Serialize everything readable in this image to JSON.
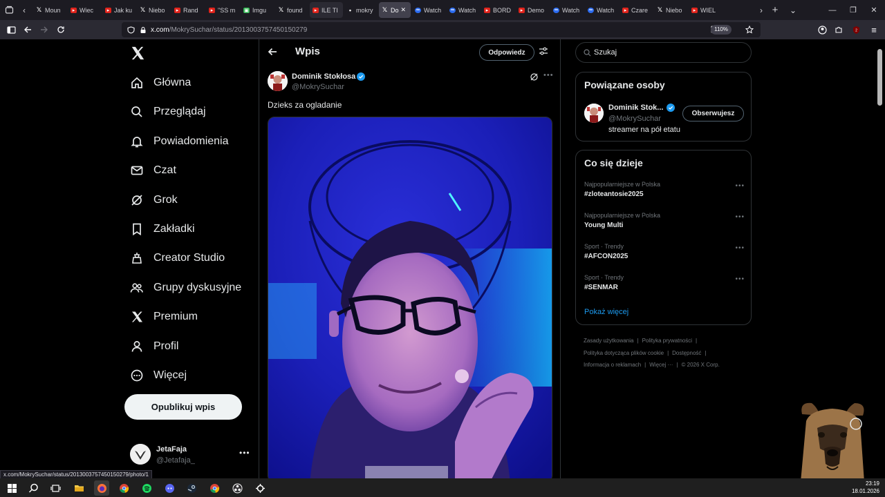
{
  "browser": {
    "tabs": [
      {
        "label": "",
        "icon": "scroll-tabs-left-icon"
      },
      {
        "label": "Moun",
        "icon": "x-logo-icon"
      },
      {
        "label": "Wiec",
        "icon": "youtube-icon"
      },
      {
        "label": "Jak ku",
        "icon": "youtube-icon"
      },
      {
        "label": "Niebo",
        "icon": "x-logo-icon"
      },
      {
        "label": "Rand",
        "icon": "youtube-icon"
      },
      {
        "label": "\"SS m",
        "icon": "youtube-icon"
      },
      {
        "label": "Imgu",
        "icon": "imgur-icon"
      },
      {
        "label": "found",
        "icon": "x-logo-icon"
      },
      {
        "label": "ILE TI",
        "icon": "youtube-icon"
      },
      {
        "label": "mokry",
        "icon": "dot-icon"
      },
      {
        "label": "Do",
        "icon": "x-logo-icon"
      },
      {
        "label": "Watch",
        "icon": "meta-icon"
      },
      {
        "label": "Watch",
        "icon": "meta-icon"
      },
      {
        "label": "BORD",
        "icon": "youtube-icon"
      },
      {
        "label": "Demo",
        "icon": "youtube-icon"
      },
      {
        "label": "Watch",
        "icon": "meta-icon"
      },
      {
        "label": "Watch",
        "icon": "meta-icon"
      },
      {
        "label": "Czare",
        "icon": "youtube-icon"
      },
      {
        "label": "Niebo",
        "icon": "x-logo-icon"
      },
      {
        "label": "WIEL",
        "icon": "youtube-icon"
      }
    ],
    "url": {
      "host": "x.com",
      "path": "/MokrySuchar/status/2013003757450150279"
    },
    "zoom": "110%",
    "status_link": "x.com/MokrySuchar/status/2013003757450150279/photo/1"
  },
  "nav": {
    "items": [
      {
        "label": "Główna",
        "icon": "home-icon"
      },
      {
        "label": "Przeglądaj",
        "icon": "search-icon"
      },
      {
        "label": "Powiadomienia",
        "icon": "bell-icon"
      },
      {
        "label": "Czat",
        "icon": "mail-icon"
      },
      {
        "label": "Grok",
        "icon": "grok-icon"
      },
      {
        "label": "Zakładki",
        "icon": "bookmark-icon"
      },
      {
        "label": "Creator Studio",
        "icon": "creator-studio-icon"
      },
      {
        "label": "Grupy dyskusyjne",
        "icon": "communities-icon"
      },
      {
        "label": "Premium",
        "icon": "x-logo-icon"
      },
      {
        "label": "Profil",
        "icon": "profile-icon"
      },
      {
        "label": "Więcej",
        "icon": "more-circle-icon"
      }
    ],
    "post_button": "Opublikuj wpis",
    "account": {
      "name": "JetaFaja",
      "handle": "@Jetafaja_"
    }
  },
  "main": {
    "title": "Wpis",
    "reply_button": "Odpowiedz",
    "post": {
      "author_name": "Dominik Stokłosa",
      "author_handle": "@MokrySuchar",
      "text": "Dzieks za ogladanie"
    }
  },
  "sidebar": {
    "search_placeholder": "Szukaj",
    "related": {
      "title": "Powiązane osoby",
      "name": "Dominik Stok...",
      "handle": "@MokrySuchar",
      "bio": "streamer na pół etatu",
      "follow_label": "Obserwujesz"
    },
    "trends": {
      "title": "Co się dzieje",
      "items": [
        {
          "meta": "Najpopularniejsze w Polska",
          "name": "#zloteantosie2025"
        },
        {
          "meta": "Najpopularniejsze w Polska",
          "name": "Young Multi"
        },
        {
          "meta": "Sport · Trendy",
          "name": "#AFCON2025"
        },
        {
          "meta": "Sport · Trendy",
          "name": "#SENMAR"
        }
      ],
      "show_more": "Pokaż więcej"
    },
    "footer": {
      "links": [
        "Zasady użytkowania",
        "Polityka prywatności",
        "Polityka dotycząca plików cookie",
        "Dostępność",
        "Informacja o reklamach",
        "Więcej ···"
      ],
      "copyright": "© 2026 X Corp."
    }
  },
  "taskbar": {
    "time": "23:19",
    "date": "18.01.2026"
  },
  "colors": {
    "accent": "#1d9bf0",
    "background": "#000000",
    "border": "#2f3336"
  }
}
